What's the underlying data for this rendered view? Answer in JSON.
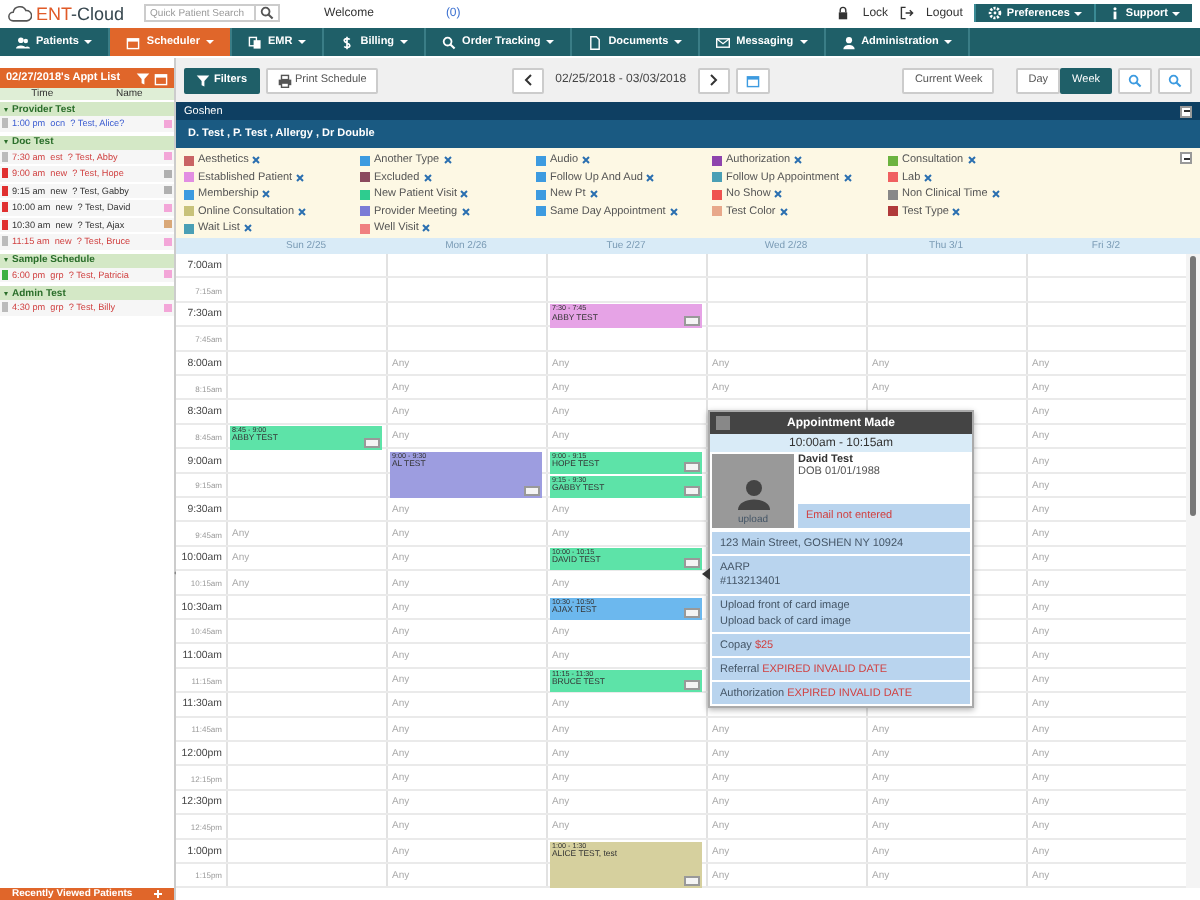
{
  "header": {
    "logo_prefix": "ENT",
    "logo_suffix": "-Cloud",
    "search": {
      "placeholder": "Quick Patient Search"
    },
    "welcome": "Welcome",
    "messages": "(0)",
    "lock": "Lock",
    "logout": "Logout",
    "menus": [
      "Preferences",
      "Support"
    ]
  },
  "nav": [
    {
      "label": "Patients",
      "selected": false
    },
    {
      "label": "Scheduler",
      "selected": true
    },
    {
      "label": "EMR",
      "selected": false
    },
    {
      "label": "Billing",
      "selected": false
    },
    {
      "label": "Order Tracking",
      "selected": false
    },
    {
      "label": "Documents",
      "selected": false
    },
    {
      "label": "Messaging",
      "selected": false
    },
    {
      "label": "Administration",
      "selected": false
    }
  ],
  "sidebar": {
    "title": "02/27/2018's Appt List",
    "columns": [
      "Time",
      "Name"
    ],
    "groups": [
      {
        "name": "Provider Test",
        "expanded": true,
        "rows": [
          {
            "time": "1:00 pm",
            "type": "ocn",
            "name": "? Test, Alice?",
            "kind": "plain",
            "warning": false,
            "info": true,
            "color": "#f3a6d8"
          }
        ]
      },
      {
        "name": "Doc Test",
        "expanded": true,
        "rows": [
          {
            "time": "7:30 am",
            "type": "est",
            "name": "? Test, Abby",
            "kind": "plain",
            "warning": true,
            "info": false,
            "color": "#f3a6d8"
          },
          {
            "time": "9:00 am",
            "type": "new",
            "name": "? Test, Hope",
            "kind": "alert",
            "warning": true,
            "info": false,
            "color": "#b0b0b0"
          },
          {
            "time": "9:15 am",
            "type": "new",
            "name": "? Test, Gabby",
            "kind": "alert",
            "warning": false,
            "info": false,
            "color": "#b0b0b0"
          },
          {
            "time": "10:00 am",
            "type": "new",
            "name": "? Test, David",
            "kind": "alert",
            "warning": false,
            "info": false,
            "color": "#f3a6d8"
          },
          {
            "time": "10:30 am",
            "type": "new",
            "name": "? Test, Ajax",
            "kind": "alert",
            "warning": false,
            "info": false,
            "color": "#d9a878"
          },
          {
            "time": "11:15 am",
            "type": "new",
            "name": "? Test, Bruce",
            "kind": "plain",
            "warning": true,
            "info": false,
            "color": "#f3a6d8"
          }
        ]
      },
      {
        "name": "Sample Schedule",
        "expanded": true,
        "rows": [
          {
            "time": "6:00 pm",
            "type": "grp",
            "name": "? Test, Patricia",
            "kind": "ok",
            "warning": true,
            "info": false,
            "color": "#f3a6d8"
          }
        ]
      },
      {
        "name": "Admin Test",
        "expanded": true,
        "rows": [
          {
            "time": "4:30 pm",
            "type": "grp",
            "name": "? Test, Billy",
            "kind": "plain",
            "warning": true,
            "info": false,
            "color": "#f3a6d8"
          }
        ]
      }
    ],
    "footer": "Recently Viewed Patients"
  },
  "toolbar": {
    "filters": "Filters",
    "print": "Print Schedule",
    "range": "02/25/2018 - 03/03/2018",
    "current": "Current Week",
    "views": [
      {
        "label": "Day",
        "selected": false
      },
      {
        "label": "Week",
        "selected": true
      }
    ]
  },
  "location": "Goshen",
  "providers": "D. Test , P. Test , Allergy , Dr Double",
  "legend": [
    {
      "label": "Aesthetics",
      "color": "#c96464"
    },
    {
      "label": "Another Type",
      "color": "#3d9be0"
    },
    {
      "label": "Audio",
      "color": "#3d9be0"
    },
    {
      "label": "Authorization",
      "color": "#8e44ad"
    },
    {
      "label": "Consultation",
      "color": "#6cb33f"
    },
    {
      "label": "Established Patient",
      "color": "#e28ee2"
    },
    {
      "label": "Excluded",
      "color": "#8b4a5e"
    },
    {
      "label": "Follow Up And Aud",
      "color": "#3d9be0"
    },
    {
      "label": "Follow Up Appointment",
      "color": "#4a9fb5"
    },
    {
      "label": "Lab",
      "color": "#f06060"
    },
    {
      "label": "Membership",
      "color": "#3d9be0"
    },
    {
      "label": "New Patient Visit",
      "color": "#2ecc8f"
    },
    {
      "label": "New Pt",
      "color": "#3d9be0"
    },
    {
      "label": "No Show",
      "color": "#ef5350"
    },
    {
      "label": "Non Clinical Time",
      "color": "#888888"
    },
    {
      "label": "Online Consultation",
      "color": "#c8c27a"
    },
    {
      "label": "Provider Meeting",
      "color": "#7b7bd6"
    },
    {
      "label": "Same Day Appointment",
      "color": "#3d9be0"
    },
    {
      "label": "Test Color",
      "color": "#e8a88a"
    },
    {
      "label": "Test Type",
      "color": "#b03a3a"
    },
    {
      "label": "Wait List",
      "color": "#4a9fb5"
    },
    {
      "label": "Well Visit",
      "color": "#f08080"
    }
  ],
  "days": [
    "Sun 2/25",
    "Mon 2/26",
    "Tue 2/27",
    "Wed 2/28",
    "Thu 3/1",
    "Fri 3/2"
  ],
  "slots": [
    {
      "time": "7:00am",
      "major": true,
      "cells": [
        "",
        "",
        "",
        "",
        "",
        ""
      ]
    },
    {
      "time": "7:15am",
      "major": false,
      "cells": [
        "",
        "",
        "",
        "",
        "",
        ""
      ]
    },
    {
      "time": "7:30am",
      "major": true,
      "cells": [
        "",
        "",
        {
          "time": "7:30 - 7:45",
          "name": "ABBY TEST",
          "color": "#e6a3e6"
        },
        "",
        "",
        ""
      ]
    },
    {
      "time": "7:45am",
      "major": false,
      "cells": [
        "",
        "",
        "",
        "",
        "",
        ""
      ]
    },
    {
      "time": "8:00am",
      "major": true,
      "cells": [
        "",
        "Any",
        "Any",
        "Any",
        "Any",
        "Any"
      ]
    },
    {
      "time": "8:15am",
      "major": false,
      "cells": [
        "",
        "Any",
        "Any",
        "Any",
        "Any",
        "Any"
      ]
    },
    {
      "time": "8:30am",
      "major": true,
      "cells": [
        "",
        "Any",
        "Any",
        "",
        "",
        "Any"
      ]
    },
    {
      "time": "8:45am",
      "major": false,
      "cells": [
        {
          "time": "8:45 - 9:00",
          "name": "ABBY TEST",
          "color": "#5de3a8"
        },
        "Any",
        "Any",
        "",
        "",
        "Any"
      ]
    },
    {
      "time": "9:00am",
      "major": true,
      "cells": [
        "",
        {
          "time": "9:00 - 9:30",
          "name": "AL TEST",
          "color": "#9d9de0"
        },
        {
          "time": "9:00 - 9:15",
          "name": "HOPE TEST",
          "color": "#5de3a8"
        },
        "",
        "",
        "Any"
      ]
    },
    {
      "time": "9:15am",
      "major": false,
      "cells": [
        "",
        "",
        {
          "time": "9:15 - 9:30",
          "name": "GABBY TEST",
          "color": "#5de3a8"
        },
        "",
        "",
        "Any"
      ]
    },
    {
      "time": "9:30am",
      "major": true,
      "cells": [
        "",
        "Any",
        "Any",
        "",
        "",
        "Any"
      ]
    },
    {
      "time": "9:45am",
      "major": false,
      "cells": [
        "Any",
        "Any",
        "Any",
        "",
        "",
        "Any"
      ]
    },
    {
      "time": "10:00am",
      "major": true,
      "cells": [
        "Any",
        "Any",
        {
          "time": "10:00 - 10:15",
          "name": "DAVID TEST",
          "color": "#5de3a8"
        },
        "",
        "",
        "Any"
      ]
    },
    {
      "time": "10:15am",
      "major": false,
      "cells": [
        "Any",
        "Any",
        "Any",
        "",
        "",
        "Any"
      ]
    },
    {
      "time": "10:30am",
      "major": true,
      "cells": [
        "",
        "Any",
        {
          "time": "10:30 - 10:50",
          "name": "AJAX TEST",
          "color": "#6cb8ee"
        },
        "",
        "",
        "Any"
      ]
    },
    {
      "time": "10:45am",
      "major": false,
      "cells": [
        "",
        "Any",
        "Any",
        "",
        "",
        "Any"
      ]
    },
    {
      "time": "11:00am",
      "major": true,
      "cells": [
        "",
        "Any",
        "Any",
        "",
        "",
        "Any"
      ]
    },
    {
      "time": "11:15am",
      "major": false,
      "cells": [
        "",
        "Any",
        {
          "time": "11:15 - 11:30",
          "name": "BRUCE TEST",
          "color": "#5de3a8"
        },
        "",
        "",
        "Any"
      ]
    },
    {
      "time": "11:30am",
      "major": true,
      "cells": [
        "",
        "Any",
        "Any",
        "",
        "",
        "Any"
      ]
    },
    {
      "time": "11:45am",
      "major": false,
      "cells": [
        "",
        "Any",
        "Any",
        "Any",
        "Any",
        "Any"
      ]
    },
    {
      "time": "12:00pm",
      "major": true,
      "cells": [
        "",
        "Any",
        "Any",
        "Any",
        "Any",
        "Any"
      ]
    },
    {
      "time": "12:15pm",
      "major": false,
      "cells": [
        "",
        "Any",
        "Any",
        "Any",
        "Any",
        "Any"
      ]
    },
    {
      "time": "12:30pm",
      "major": true,
      "cells": [
        "",
        "Any",
        "Any",
        "Any",
        "Any",
        "Any"
      ]
    },
    {
      "time": "12:45pm",
      "major": false,
      "cells": [
        "",
        "Any",
        "Any",
        "Any",
        "Any",
        "Any"
      ]
    },
    {
      "time": "1:00pm",
      "major": true,
      "cells": [
        "",
        "Any",
        {
          "time": "1:00 - 1:30",
          "name": "ALICE TEST, test",
          "color": "#d6d09e"
        },
        "Any",
        "Any",
        "Any"
      ]
    },
    {
      "time": "1:15pm",
      "major": false,
      "cells": [
        "",
        "Any",
        "",
        "Any",
        "Any",
        "Any"
      ]
    }
  ],
  "popup": {
    "title": "Appointment Made",
    "time": "10:00am - 10:15am",
    "upload": "upload",
    "patient": "David Test",
    "dob": "DOB 01/01/1988",
    "email": "Email not entered",
    "address": "123 Main Street, GOSHEN NY 10924",
    "insurance": [
      "AARP",
      "#113213401"
    ],
    "card": [
      "Upload front of card image",
      "Upload back of card image"
    ],
    "fields": [
      {
        "label": "Copay",
        "value": "$25"
      },
      {
        "label": "Referral",
        "value": "EXPIRED INVALID DATE"
      },
      {
        "label": "Authorization",
        "value": "EXPIRED INVALID DATE"
      }
    ]
  }
}
